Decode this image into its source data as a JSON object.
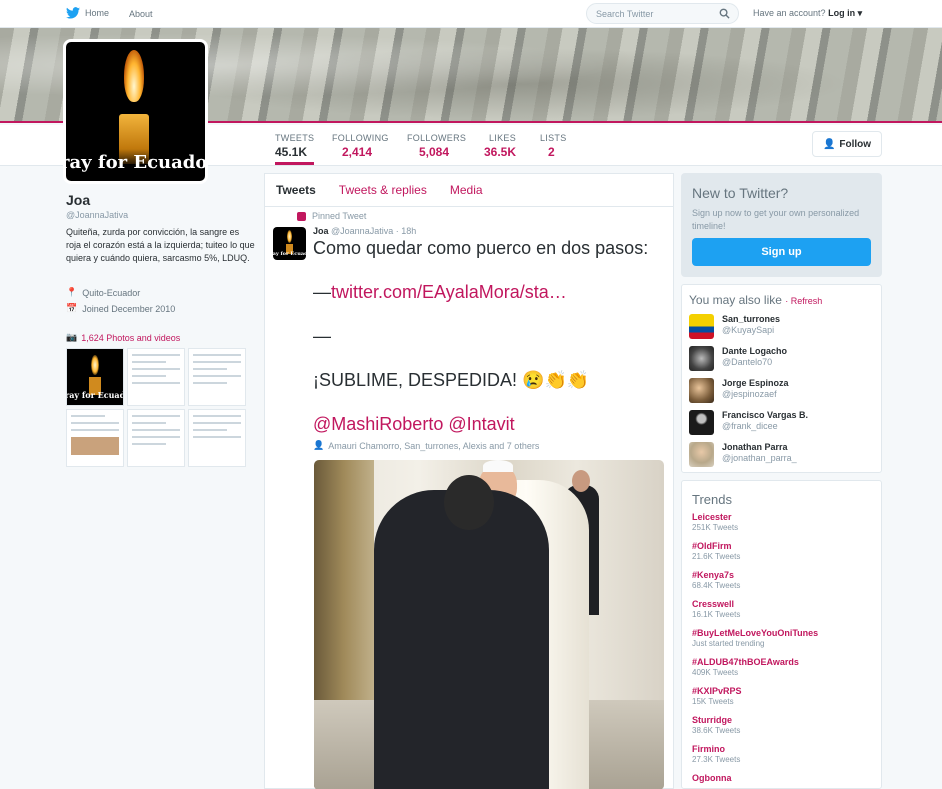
{
  "nav": {
    "home": "Home",
    "about": "About",
    "search_placeholder": "Search Twitter",
    "have_account": "Have an account?",
    "login": "Log in"
  },
  "profile": {
    "avatar_text": "ray for Ecuado",
    "name": "Joa",
    "handle": "@JoannaJativa",
    "bio": "Quiteña, zurda por convicción, la sangre es roja el corazón está a la izquierda; tuiteo lo que quiera y cuándo quiera, sarcasmo 5%, LDUQ.",
    "location": "Quito-Ecuador",
    "joined": "Joined December 2010",
    "photos": "1,624 Photos and videos"
  },
  "stats": [
    {
      "label": "TWEETS",
      "value": "45.1K"
    },
    {
      "label": "FOLLOWING",
      "value": "2,414"
    },
    {
      "label": "FOLLOWERS",
      "value": "5,084"
    },
    {
      "label": "LIKES",
      "value": "36.5K"
    },
    {
      "label": "LISTS",
      "value": "2"
    }
  ],
  "follow_button": "Follow",
  "tabs": [
    "Tweets",
    "Tweets & replies",
    "Media"
  ],
  "tweet": {
    "pinned": "Pinned Tweet",
    "name": "Joa",
    "handle": "@JoannaJativa",
    "time": "· 18h",
    "line1": "Como quedar como puerco en dos pasos:",
    "line2_prefix": "—",
    "link": "twitter.com/EAyalaMora/sta…",
    "line3": "—",
    "line4": "¡SUBLIME, DESPEDIDA! 😢👏👏",
    "mentions": "@MashiRoberto @Intavit",
    "retweeters": "Amauri Chamorro, San_turrones, Alexis and 7 others"
  },
  "new_to_twitter": {
    "title": "New to Twitter?",
    "text": "Sign up now to get your own personalized timeline!",
    "button": "Sign up"
  },
  "wtf": {
    "title": "You may also like",
    "refresh": "Refresh",
    "items": [
      {
        "name": "San_turrones",
        "handle": "@KuyaySapi",
        "color": "#d4a017"
      },
      {
        "name": "Dante Logacho",
        "handle": "@Dantelo70",
        "color": "#555555"
      },
      {
        "name": "Jorge Espinoza",
        "handle": "@jespinozaef",
        "color": "#7a5c3a"
      },
      {
        "name": "Francisco Vargas B.",
        "handle": "@frank_dicee",
        "color": "#1a1a1a"
      },
      {
        "name": "Jonathan Parra",
        "handle": "@jonathan_parra_",
        "color": "#b8a88a"
      }
    ]
  },
  "trends": {
    "title": "Trends",
    "items": [
      {
        "name": "Leicester",
        "count": "251K Tweets"
      },
      {
        "name": "#OldFirm",
        "count": "21.6K Tweets"
      },
      {
        "name": "#Kenya7s",
        "count": "68.4K Tweets"
      },
      {
        "name": "Cresswell",
        "count": "16.1K Tweets"
      },
      {
        "name": "#BuyLetMeLoveYouOniTunes",
        "count": "Just started trending"
      },
      {
        "name": "#ALDUB47thBOEAwards",
        "count": "409K Tweets"
      },
      {
        "name": "#KXIPvRPS",
        "count": "15K Tweets"
      },
      {
        "name": "Sturridge",
        "count": "38.6K Tweets"
      },
      {
        "name": "Firmino",
        "count": "27.3K Tweets"
      },
      {
        "name": "Ogbonna",
        "count": ""
      }
    ]
  }
}
